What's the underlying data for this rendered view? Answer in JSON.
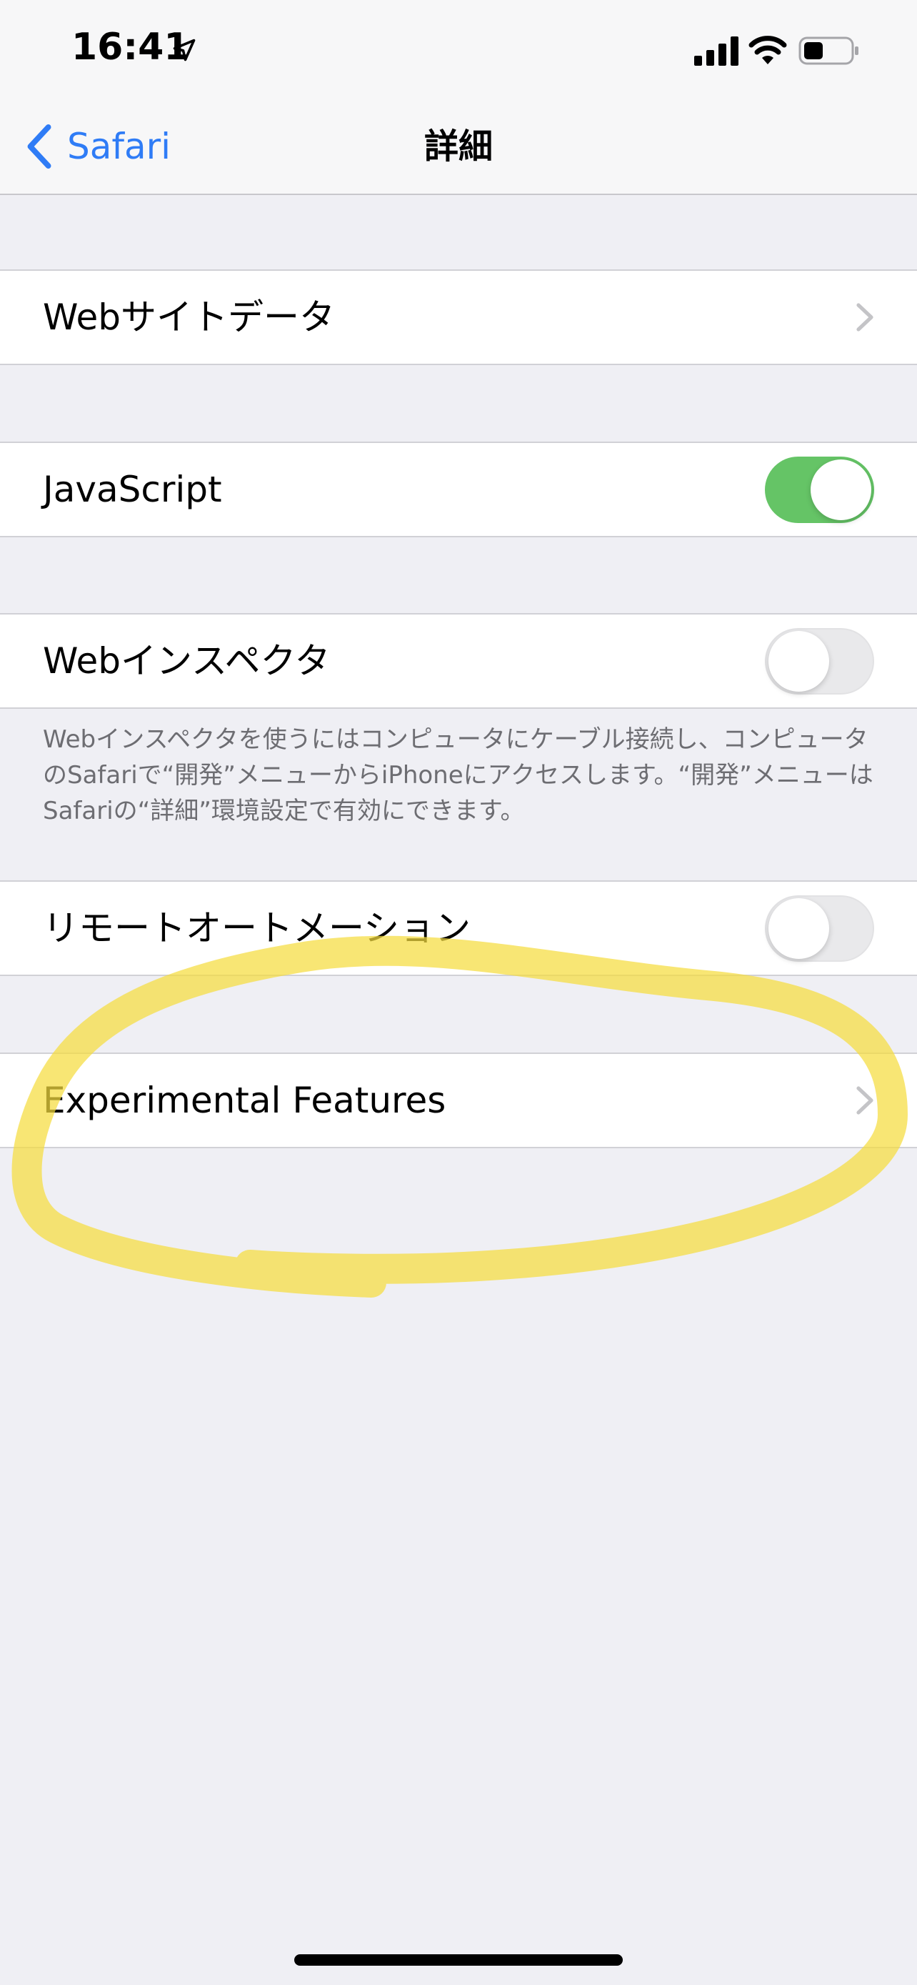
{
  "status_bar": {
    "time": "16:41",
    "icons": [
      "location-arrow-icon",
      "signal-icon",
      "wifi-icon",
      "battery-icon"
    ]
  },
  "nav": {
    "back_label": "Safari",
    "title": "詳細"
  },
  "rows": {
    "website_data": {
      "label": "Webサイトデータ"
    },
    "javascript": {
      "label": "JavaScript",
      "toggle_on": true
    },
    "web_inspector": {
      "label": "Webインスペクタ",
      "toggle_on": false
    },
    "remote_automation": {
      "label": "リモートオートメーション",
      "toggle_on": false
    },
    "experimental_features": {
      "label": "Experimental Features"
    }
  },
  "web_inspector_footnote": "Webインスペクタを使うにはコンピュータにケーブル接続し、コンピュータのSafariで“開発”メニューからiPhoneにアクセスします。“開発”メニューはSafariの“詳細”環境設定で有効にできます。",
  "colors": {
    "accent": "#2f7cf6",
    "toggle_on": "#65c466",
    "highlight": "#f7e25a"
  }
}
